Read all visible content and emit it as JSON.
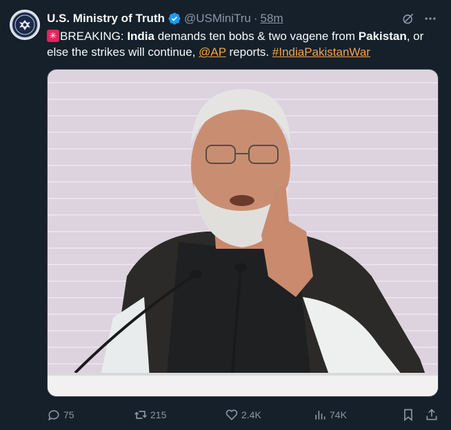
{
  "author": {
    "display_name": "U.S. Ministry of Truth",
    "handle": "@USMiniTru",
    "separator": "·",
    "time": "58m",
    "avatar_icon": "seal-eagle-icon",
    "verified_color": "#1d9bf0"
  },
  "tweet": {
    "segments": {
      "emoji": "🚨",
      "lead": "BREAKING: ",
      "india": "India",
      "t1": " demands ten bobs & two vagene from ",
      "pakistan": "Pakistan",
      "t2": ", or else the strikes will continue, ",
      "mention": "@AP",
      "t3": " reports. ",
      "hashtag": "#IndiaPakistanWar"
    },
    "link_color": "#f7a24a"
  },
  "actions": {
    "replies": "75",
    "retweets": "215",
    "likes": "2.4K",
    "views": "74K"
  },
  "media": {
    "kind": "photo",
    "subject": "man speaking at podium"
  }
}
